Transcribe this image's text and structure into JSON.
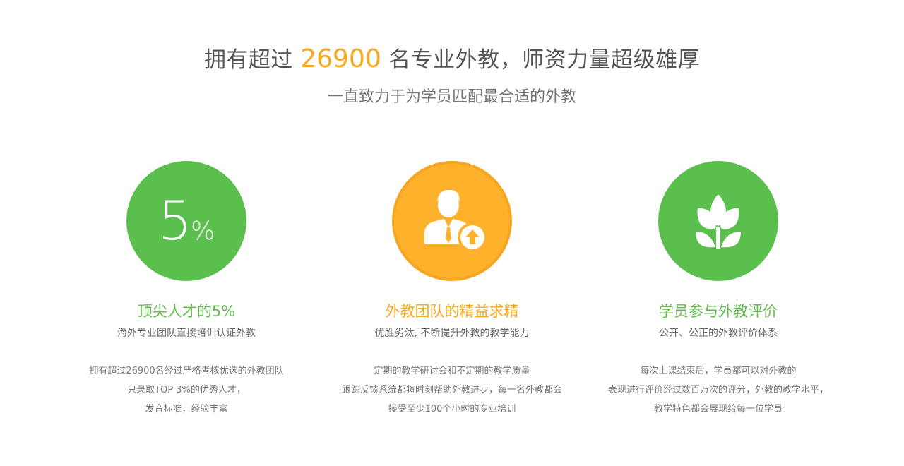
{
  "header": {
    "headline_pre": "拥有超过",
    "headline_number": "26900",
    "headline_post": "名专业外教，师资力量超级雄厚",
    "subheadline": "一直致力于为学员匹配最合适的外教"
  },
  "features": [
    {
      "badge_number": "5",
      "badge_unit": "%",
      "title": "顶尖人才的5%",
      "subtitle": "海外专业团队直接培训认证外教",
      "lines": [
        "拥有超过26900名经过严格考核优选的外教团队",
        "只录取TOP 3%的优秀人才，",
        "发音标准，经验丰富"
      ]
    },
    {
      "icon": "teacher-upgrade-icon",
      "title": "外教团队的精益求精",
      "subtitle": "优胜劣汰, 不断提升外教的教学能力",
      "lines": [
        "定期的教学研讨会和不定期的教学质量",
        "跟踪反馈系统都将时刻帮助外教进步，每一名外教都会",
        "接受至少100个小时的专业培训"
      ]
    },
    {
      "icon": "tulip-icon",
      "title": "学员参与外教评价",
      "subtitle": "公开、公正的外教评价体系",
      "lines": [
        "每次上课结束后，学员都可以对外教的",
        "表现进行评价经过数百万次的评分，外教的教学水平，",
        "教学特色都会展现给每一位学员"
      ]
    }
  ],
  "colors": {
    "green": "#5bbf4e",
    "orange": "#feb12b",
    "accent_number": "#f8a91c"
  }
}
